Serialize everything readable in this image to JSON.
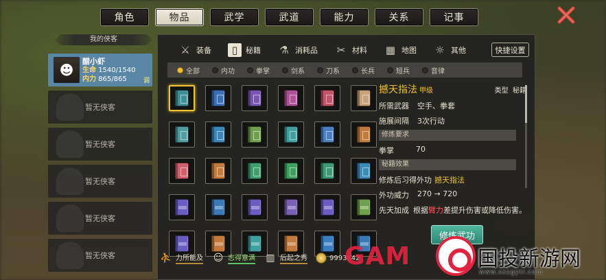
{
  "top_tabs": [
    "角色",
    "物品",
    "武学",
    "武道",
    "能力",
    "关系",
    "记事"
  ],
  "active_tab": 1,
  "colors": {
    "accent": "#f1c232",
    "close": "#d9463c",
    "active_slot": "#5a86a6",
    "train_button": "#3a9c84"
  },
  "party": {
    "header": "我的侠客",
    "hero": {
      "name": "醋小虾",
      "hp_label": "生命",
      "hp": "1540/1540",
      "mp_label": "内力",
      "mp": "865/865",
      "tune": "调"
    },
    "empty_label": "暂无侠客",
    "empty_slots": 5
  },
  "categories": [
    {
      "label": "装备",
      "icon": "bag-icon",
      "glyph": "⚔"
    },
    {
      "label": "秘籍",
      "icon": "book-icon",
      "glyph": "▯"
    },
    {
      "label": "消耗品",
      "icon": "potion-icon",
      "glyph": "⚗"
    },
    {
      "label": "材料",
      "icon": "material-icon",
      "glyph": "✂"
    },
    {
      "label": "地图",
      "icon": "map-icon",
      "glyph": "▦"
    },
    {
      "label": "其他",
      "icon": "lamp-icon",
      "glyph": "☼"
    }
  ],
  "active_category": 1,
  "quick_settings": "快捷设置",
  "filters": [
    "全部",
    "内功",
    "拳掌",
    "剑系",
    "刀系",
    "长兵",
    "短兵",
    "音律"
  ],
  "active_filter": 0,
  "book_colors": [
    "#3e8f96",
    "#3c6fb6",
    "#7a56b4",
    "#b0529a",
    "#c45468",
    "#c7a27a",
    "#4e9ca0",
    "#3a86b8",
    "#6ea04c",
    "#3ea0a0",
    "#4a7ec0",
    "#c07a3c",
    "#d0606c",
    "#c47a3c",
    "#3ea06e",
    "#3ea05e",
    "#3d9a78",
    "#3c8ab8",
    "#6a5cc0",
    "#3a78b6",
    "#6a5cc0",
    "#7a60b4",
    "#6a5cc0",
    "#6ea04c",
    "#6a5cc0",
    "#c47a3c",
    "#3ea0a0",
    "#c47a3c",
    "#3a7ec0",
    "#3a78b6"
  ],
  "book_banded_from": 18,
  "selected_book": 0,
  "detail": {
    "name": "撼天指法",
    "grade": "甲级",
    "type_label": "类型",
    "type_value": "秘籍",
    "weapon_label": "所需武器",
    "weapon_value": "空手、拳套",
    "interval_label": "施展间隔",
    "interval_value": "3次行动",
    "req_header": "修炼要求",
    "req_key": "拳掌",
    "req_value": "70",
    "effect_header": "秘籍效果",
    "learn_label": "修炼后习得外功",
    "learn_value": "撼天指法",
    "power_label": "外功威力",
    "power_value": "270 → 720",
    "innate_label": "先天加成",
    "innate_pre": "根据",
    "innate_hl": "臂力",
    "innate_post": "差提升伤害或降低伤害。"
  },
  "train_button": "修炼武功",
  "status": [
    {
      "icon": "strength-icon",
      "glyph": "⛹",
      "label": "力所能及"
    },
    {
      "icon": "face-icon",
      "glyph": "☺",
      "label": "志得意满"
    },
    {
      "icon": "piano-icon",
      "glyph": "▥",
      "label": "后起之秀"
    }
  ],
  "money_partial": "9993842",
  "watermark": {
    "text": "国投新游网",
    "url": "www.sxsgytr.com",
    "brand": "GAM"
  }
}
